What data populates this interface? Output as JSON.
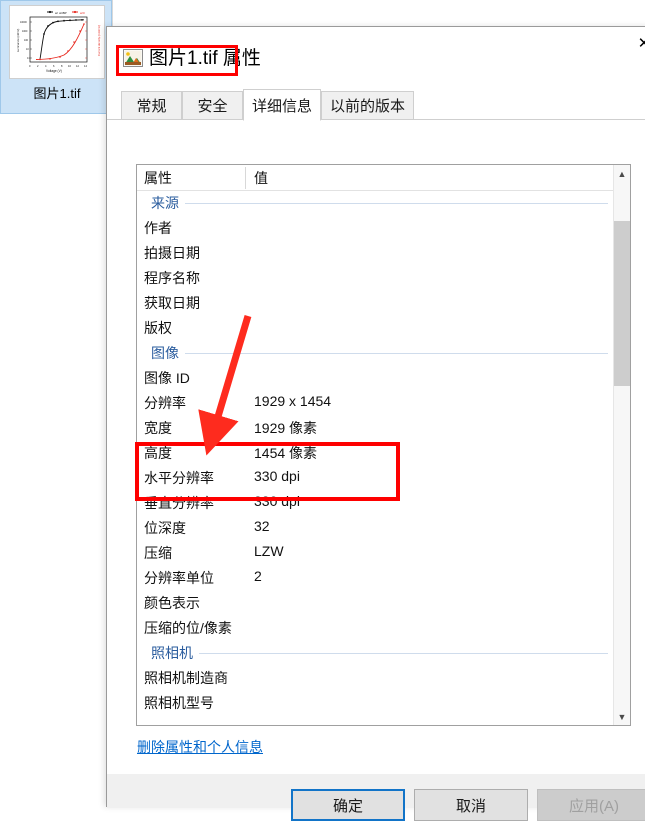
{
  "explorer": {
    "file_tile": {
      "file_name": "图片1.tif",
      "thumbnail": {
        "type": "line",
        "xlabel": "Voltage (V)",
        "ylabel_left": "Luminance (cd/m²)",
        "ylabel_right": "Current density (mA/cm²)",
        "legend": [
          "w/ oCBP",
          "w/o"
        ]
      }
    }
  },
  "dialog": {
    "title": "图片1.tif 属性",
    "title_icon": "picture-file-icon",
    "close_icon": "close-icon",
    "tabs": [
      {
        "label": "常规",
        "active": false
      },
      {
        "label": "安全",
        "active": false
      },
      {
        "label": "详细信息",
        "active": true
      },
      {
        "label": "以前的版本",
        "active": false
      }
    ],
    "list": {
      "columns": {
        "property": "属性",
        "value": "值"
      },
      "rows": [
        {
          "group": true,
          "name": "来源",
          "value": ""
        },
        {
          "group": false,
          "name": "作者",
          "value": ""
        },
        {
          "group": false,
          "name": "拍摄日期",
          "value": ""
        },
        {
          "group": false,
          "name": "程序名称",
          "value": ""
        },
        {
          "group": false,
          "name": "获取日期",
          "value": ""
        },
        {
          "group": false,
          "name": "版权",
          "value": ""
        },
        {
          "group": true,
          "name": "图像",
          "value": ""
        },
        {
          "group": false,
          "name": "图像 ID",
          "value": ""
        },
        {
          "group": false,
          "name": "分辨率",
          "value": "1929 x 1454"
        },
        {
          "group": false,
          "name": "宽度",
          "value": "1929 像素"
        },
        {
          "group": false,
          "name": "高度",
          "value": "1454 像素"
        },
        {
          "group": false,
          "name": "水平分辨率",
          "value": "330 dpi"
        },
        {
          "group": false,
          "name": "垂直分辨率",
          "value": "330 dpi"
        },
        {
          "group": false,
          "name": "位深度",
          "value": "32"
        },
        {
          "group": false,
          "name": "压缩",
          "value": "LZW"
        },
        {
          "group": false,
          "name": "分辨率单位",
          "value": "2"
        },
        {
          "group": false,
          "name": "颜色表示",
          "value": ""
        },
        {
          "group": false,
          "name": "压缩的位/像素",
          "value": ""
        },
        {
          "group": true,
          "name": "照相机",
          "value": ""
        },
        {
          "group": false,
          "name": "照相机制造商",
          "value": ""
        },
        {
          "group": false,
          "name": "照相机型号",
          "value": ""
        }
      ]
    },
    "scrollbar": {
      "up_icon": "chevron-up-icon",
      "down_icon": "chevron-down-icon"
    },
    "remove_link": "删除属性和个人信息",
    "buttons": {
      "ok": "确定",
      "cancel": "取消",
      "apply": "应用(A)"
    }
  },
  "annotations": {
    "highlight_color": "#fe0000",
    "title_box": "图片1.tif 属性",
    "dpi_box": "水平分辨率 / 垂直分辨率 330 dpi",
    "arrow": "red-arrow-pointing-to-dpi-rows"
  }
}
